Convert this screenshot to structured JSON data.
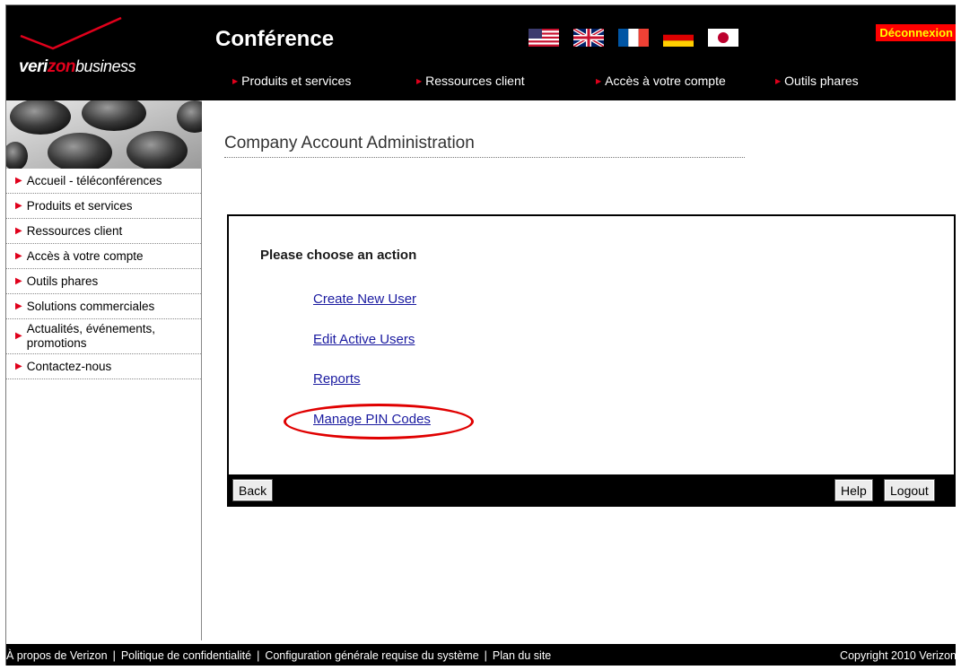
{
  "header": {
    "brand_bold": "veri",
    "brand_red": "zon",
    "brand_bold2": "",
    "brand_rest": "business",
    "title": "Conférence",
    "logout_label": "Déconnexion",
    "flags": [
      "us-flag-icon",
      "uk-flag-icon",
      "france-flag-icon",
      "germany-flag-icon",
      "japan-flag-icon"
    ],
    "nav": [
      "Produits et services",
      "Ressources client",
      "Accès à votre compte",
      "Outils phares"
    ]
  },
  "sidebar": {
    "items": [
      "Accueil - téléconférences",
      "Produits et services",
      "Ressources client",
      "Accès à votre compte",
      "Outils phares",
      "Solutions commerciales",
      "Actualités, événements, promotions",
      "Contactez-nous"
    ]
  },
  "main": {
    "title": "Company Account Administration",
    "panel": {
      "heading": "Please choose an action",
      "actions": [
        "Create New User",
        "Edit Active Users",
        "Reports",
        "Manage PIN Codes"
      ],
      "highlighted_action": "Manage PIN Codes",
      "buttons": {
        "back": "Back",
        "help": "Help",
        "logout": "Logout"
      }
    }
  },
  "footer": {
    "links": [
      "À propos de Verizon",
      "Politique de confidentialité",
      "Configuration générale requise du système",
      "Plan du site"
    ],
    "copyright": "Copyright 2010 Verizon"
  },
  "colors": {
    "header_bg": "#000000",
    "accent_red": "#e0001b",
    "link_blue": "#1a1aa0",
    "logout_bg": "#ff0000",
    "logout_text": "#ffff00"
  }
}
